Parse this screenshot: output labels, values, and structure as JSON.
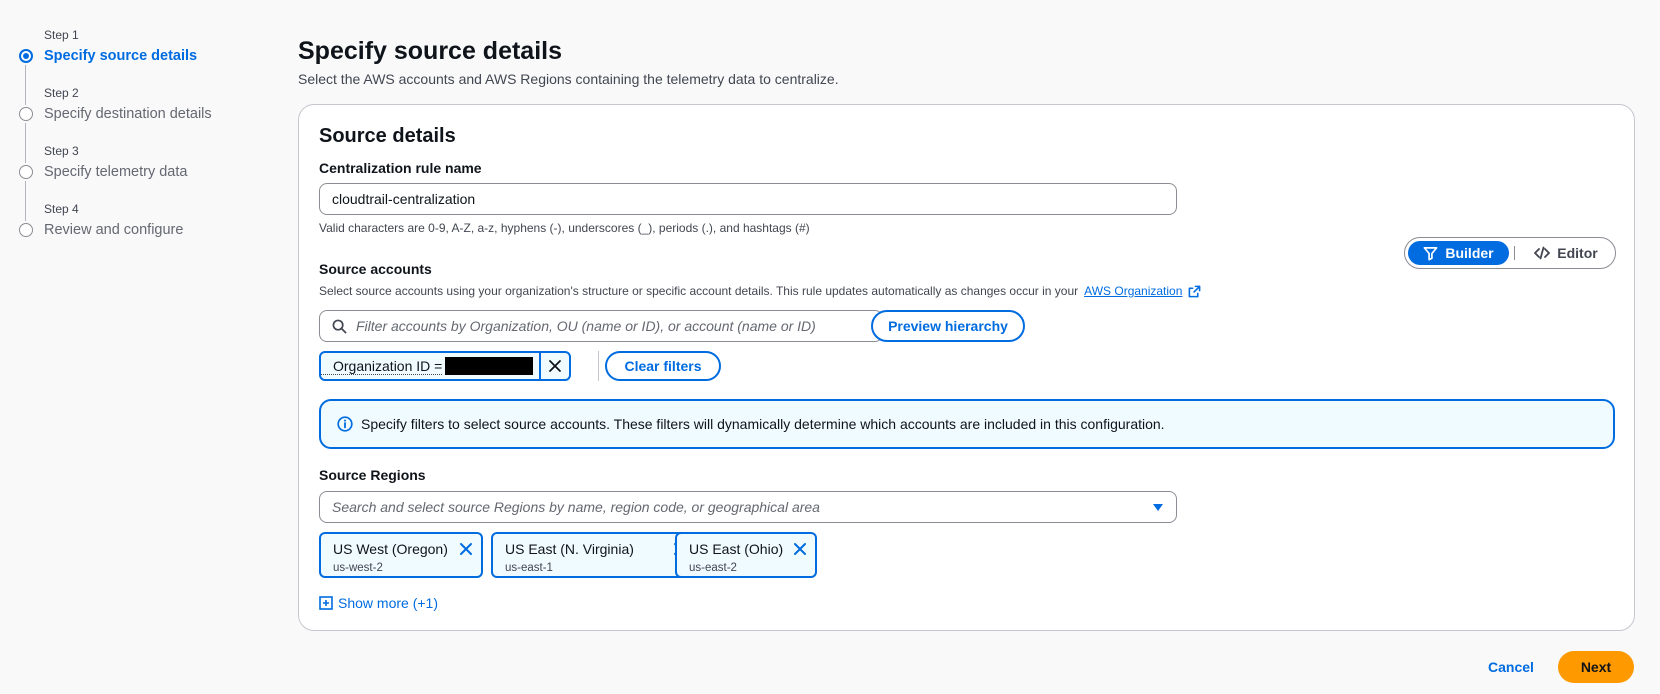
{
  "wizard": {
    "steps": [
      {
        "num": "Step 1",
        "title": "Specify source details"
      },
      {
        "num": "Step 2",
        "title": "Specify destination details"
      },
      {
        "num": "Step 3",
        "title": "Specify telemetry data"
      },
      {
        "num": "Step 4",
        "title": "Review and configure"
      }
    ],
    "active_step": 1
  },
  "header": {
    "title": "Specify source details",
    "description": "Select the AWS accounts and AWS Regions containing the telemetry data to centralize."
  },
  "source_details": {
    "title": "Source details",
    "rule_name": {
      "label": "Centralization rule name",
      "value": "cloudtrail-centralization",
      "hint": "Valid characters are 0-9, A-Z, a-z, hyphens (-), underscores (_), periods (.), and hashtags (#)"
    },
    "source_accounts": {
      "label": "Source accounts",
      "description": "Select source accounts using your organization's structure or specific account details. This rule updates automatically as changes occur in your",
      "org_link": "AWS Organization",
      "filter_placeholder": "Filter accounts by Organization, OU (name or ID), or account (name or ID)",
      "preview_button": "Preview hierarchy",
      "token_label": "Organization ID =",
      "clear_filters": "Clear filters",
      "info_message": "Specify filters to select source accounts. These filters will dynamically determine which accounts are included in this configuration."
    },
    "mode_toggle": {
      "builder": "Builder",
      "editor": "Editor",
      "selected": "Builder"
    },
    "source_regions": {
      "label": "Source Regions",
      "placeholder": "Search and select source Regions by name, region code, or geographical area",
      "selected": [
        {
          "name": "US West (Oregon)",
          "code": "us-west-2"
        },
        {
          "name": "US East (N. Virginia)",
          "code": "us-east-1"
        },
        {
          "name": "US East (Ohio)",
          "code": "us-east-2"
        }
      ],
      "show_more": "Show more (+1)"
    }
  },
  "footer": {
    "cancel": "Cancel",
    "next": "Next"
  },
  "colors": {
    "accent": "#006ce0",
    "primary_button": "#ff9900",
    "info_bg": "#f0fbff"
  }
}
